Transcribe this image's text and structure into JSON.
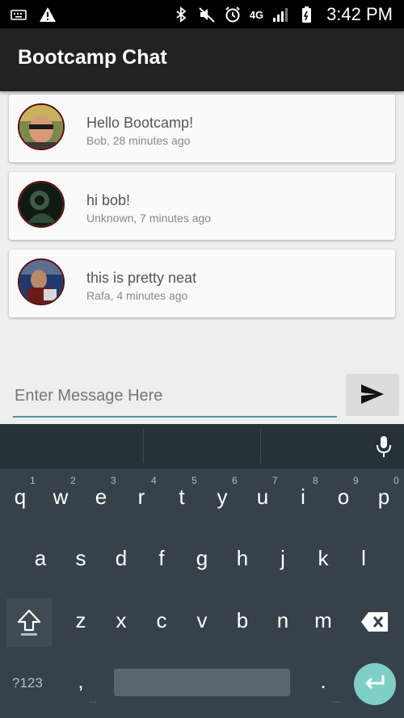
{
  "status_bar": {
    "time": "3:42 PM",
    "network": "4G"
  },
  "app": {
    "title": "Bootcamp Chat"
  },
  "messages": [
    {
      "text": "Hello Bootcamp!",
      "meta": "Bob, 28 minutes ago"
    },
    {
      "text": "hi bob!",
      "meta": "Unknown, 7 minutes ago"
    },
    {
      "text": "this is pretty neat",
      "meta": "Rafa, 4 minutes ago"
    }
  ],
  "composer": {
    "placeholder": "Enter Message Here",
    "value": ""
  },
  "keyboard": {
    "row1": [
      "q",
      "w",
      "e",
      "r",
      "t",
      "y",
      "u",
      "i",
      "o",
      "p"
    ],
    "row1_nums": [
      "1",
      "2",
      "3",
      "4",
      "5",
      "6",
      "7",
      "8",
      "9",
      "0"
    ],
    "row2": [
      "a",
      "s",
      "d",
      "f",
      "g",
      "h",
      "j",
      "k",
      "l"
    ],
    "row3": [
      "z",
      "x",
      "c",
      "v",
      "b",
      "n",
      "m"
    ],
    "symbols_label": "?123",
    "comma": ",",
    "period": "."
  }
}
